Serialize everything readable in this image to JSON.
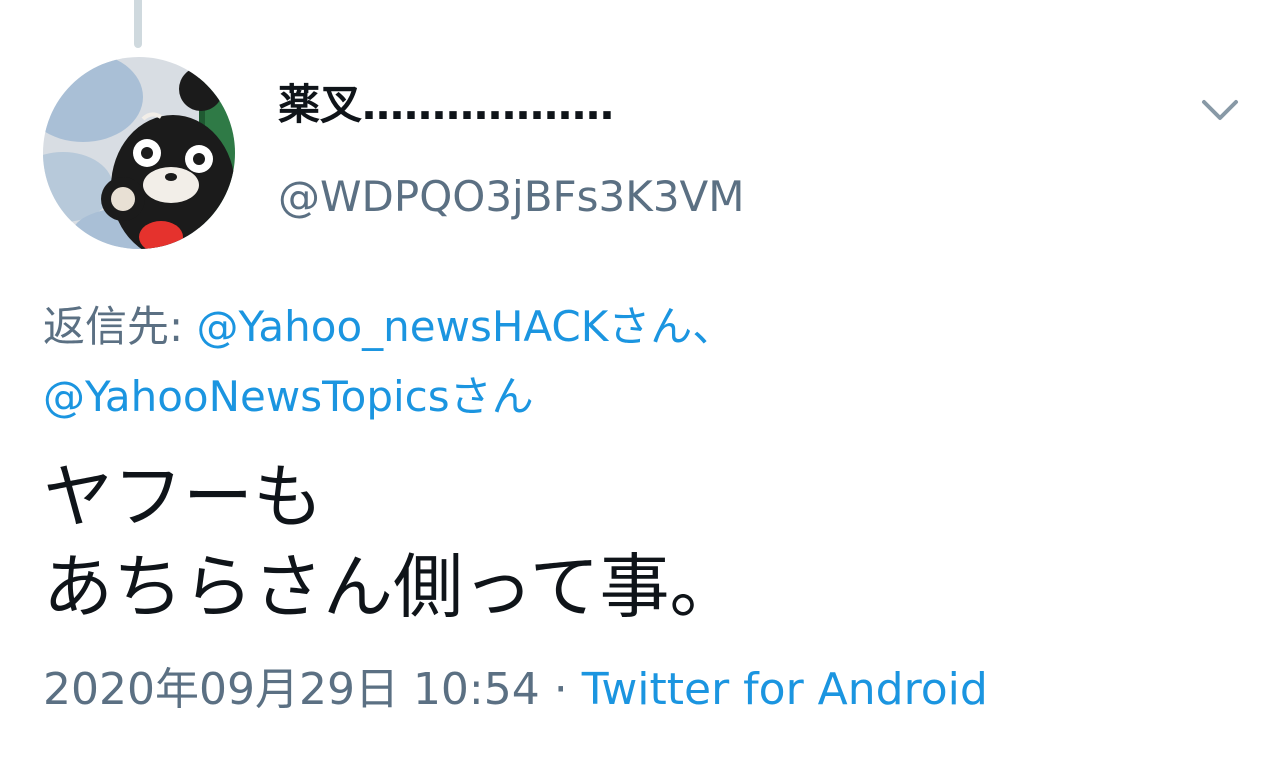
{
  "tweet": {
    "display_name": "薬叉………………",
    "handle": "@WDPQO3jBFs3K3VM",
    "reply_prefix": "返信先: ",
    "reply_mention_1": "@Yahoo_newsHACKさん",
    "reply_separator": "、",
    "reply_mention_2": "@YahooNewsTopicsさん",
    "text_line_1": "ヤフーも",
    "text_line_2": "あちらさん側って事。",
    "timestamp": "2020年09月29日 10:54",
    "dot": " · ",
    "source": "Twitter for Android"
  },
  "icons": {
    "menu": "chevron-down-icon",
    "avatar": "kumamon-avatar"
  },
  "colors": {
    "text": "#0f1419",
    "secondary": "#5b7083",
    "link": "#1b95e0",
    "thread_line": "#cfd9de"
  }
}
